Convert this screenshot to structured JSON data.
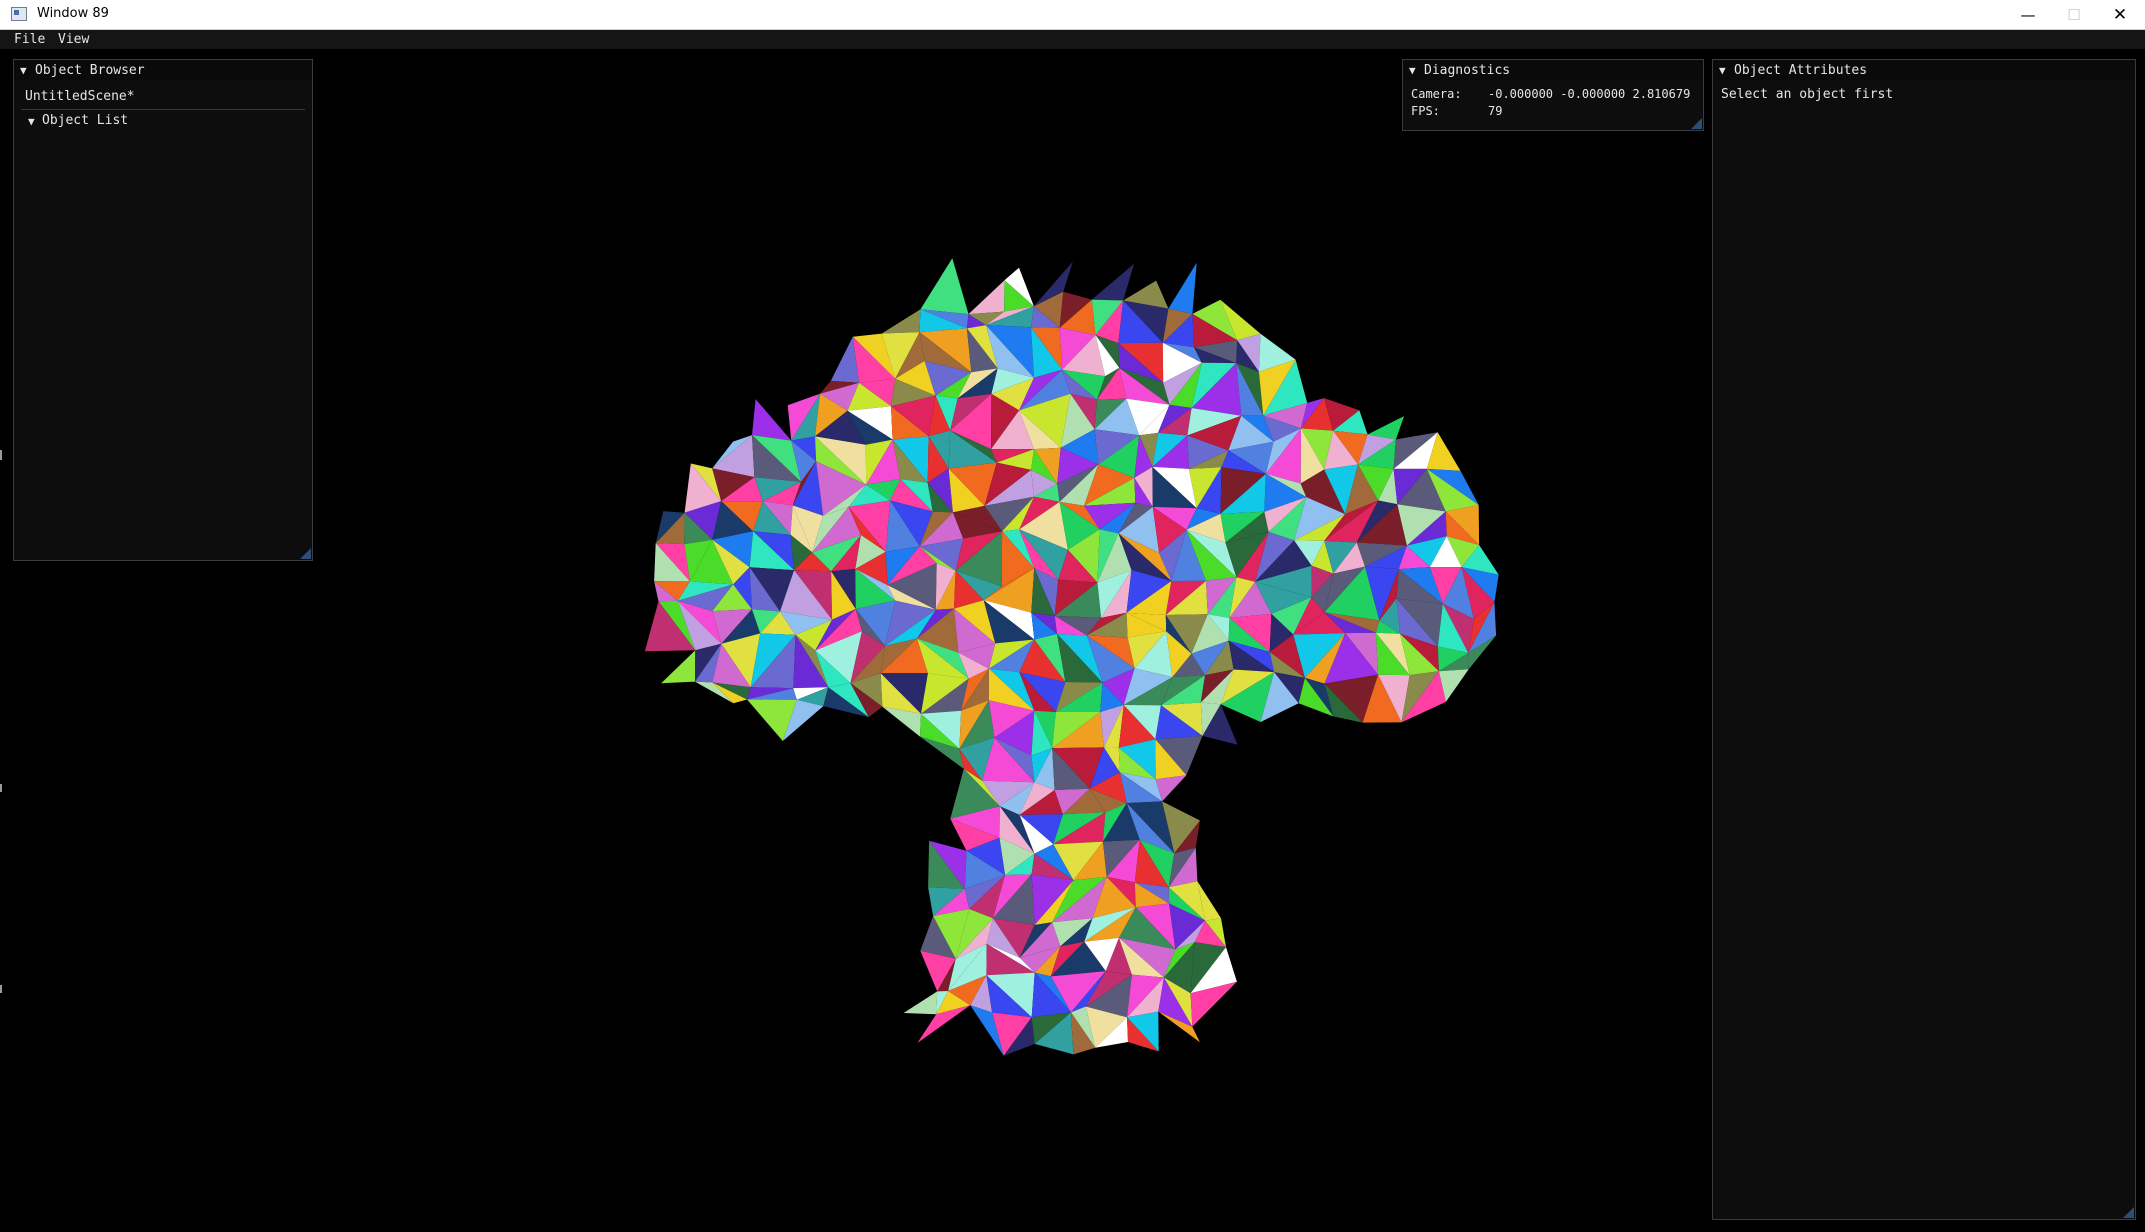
{
  "window": {
    "title": "Window 89",
    "minimize_glyph": "—",
    "maximize_glyph": "☐",
    "close_glyph": "✕",
    "icon": "app-window-icon"
  },
  "menu": {
    "items": [
      "File",
      "View"
    ]
  },
  "object_browser": {
    "header": "Object Browser",
    "scene_name": "UntitledScene*",
    "list_header": "Object List"
  },
  "diagnostics": {
    "header": "Diagnostics",
    "camera_label": "Camera:",
    "camera_value": "-0.000000 -0.000000 2.810679",
    "fps_label": "FPS:",
    "fps_value": "79"
  },
  "object_attributes": {
    "header": "Object Attributes",
    "message": "Select an object first"
  },
  "ui_colors": {
    "panel_bg": "#0d0d0d",
    "panel_border": "#3c3c3c",
    "viewport_bg": "#000000",
    "resize_grip": "#2b4d78"
  },
  "disclosure_glyph": "▼"
}
